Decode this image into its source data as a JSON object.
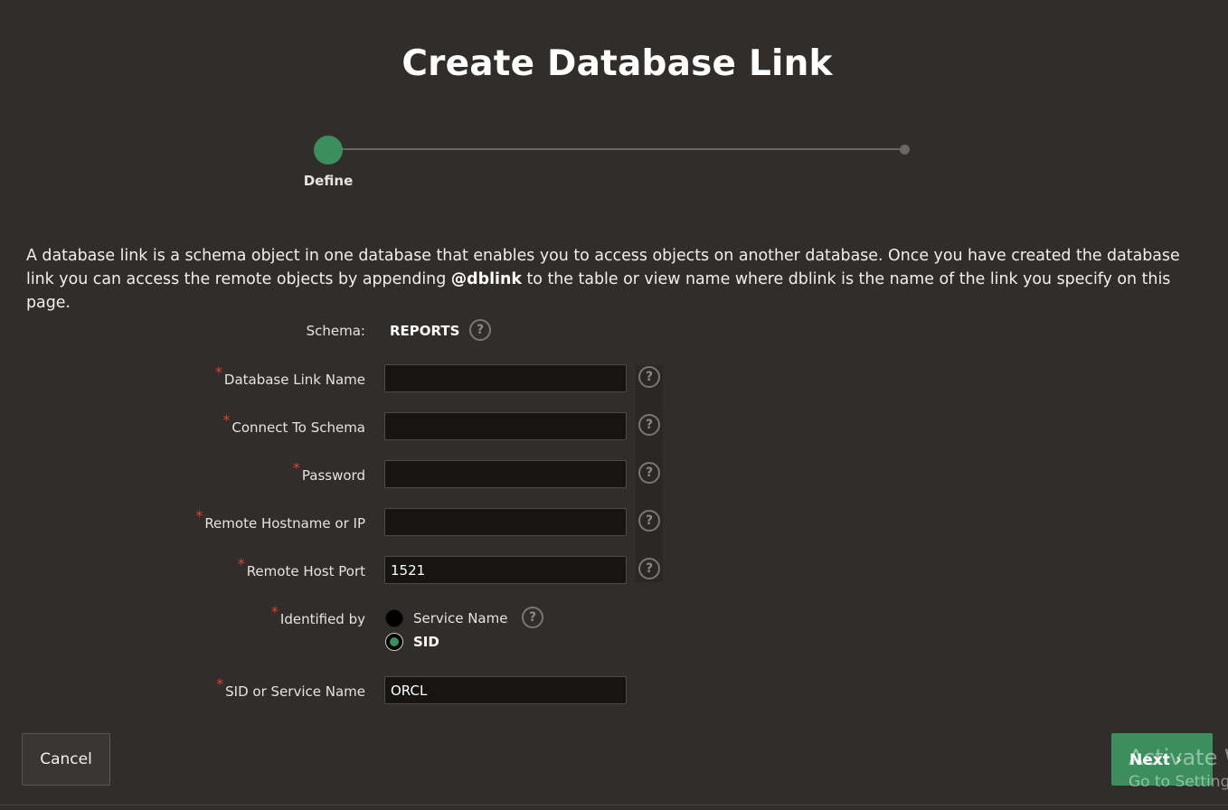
{
  "page": {
    "title": "Create Database Link",
    "description_part1": "A database link is a schema object in one database that enables you to access objects on another database. Once you have created the database link you can access the remote objects by appending ",
    "description_bold": "@dblink",
    "description_part2": " to the table or view name where dblink is the name of the link you specify on this page."
  },
  "progress": {
    "steps": [
      {
        "label": "Define",
        "active": true
      },
      {
        "label": "",
        "active": false
      }
    ]
  },
  "form": {
    "schema_label": "Schema:",
    "schema_value": "REPORTS",
    "required_marker": "*",
    "help_glyph": "?",
    "fields": {
      "db_link_name": {
        "label": "Database Link Name",
        "value": ""
      },
      "connect_to_schema": {
        "label": "Connect To Schema",
        "value": ""
      },
      "password": {
        "label": "Password",
        "value": ""
      },
      "remote_hostname": {
        "label": "Remote Hostname or IP",
        "value": ""
      },
      "remote_host_port": {
        "label": "Remote Host Port",
        "value": "1521"
      },
      "identified_by": {
        "label": "Identified by",
        "options": [
          "Service Name",
          "SID"
        ],
        "selected": "SID"
      },
      "sid_or_service_name": {
        "label": "SID or Service Name",
        "value": "ORCL"
      }
    }
  },
  "buttons": {
    "cancel": "Cancel",
    "next": "Next"
  },
  "watermark": {
    "line1": "Activate Windows",
    "line2": "Go to Settings to activate Windows."
  },
  "colors": {
    "background": "#312d2a",
    "accent": "#3a8f5c",
    "required": "#e0422d"
  }
}
